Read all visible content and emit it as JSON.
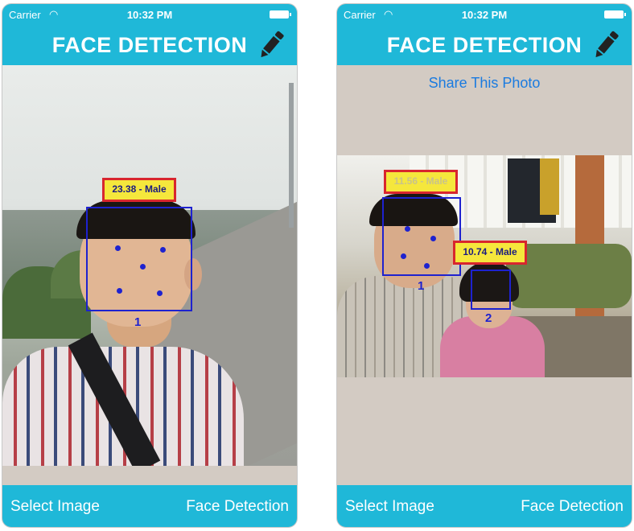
{
  "status": {
    "carrier": "Carrier",
    "time": "10:32 PM"
  },
  "header": {
    "title": "FACE DETECTION"
  },
  "share_label": "Share This Photo",
  "footer": {
    "left_label": "Select Image",
    "right_label": "Face Detection"
  },
  "left_screen": {
    "faces": [
      {
        "label": "23.38 - Male",
        "number": "1"
      }
    ]
  },
  "right_screen": {
    "faces": [
      {
        "label": "11.56 - Male",
        "number": "1"
      },
      {
        "label": "10.74 - Male",
        "number": "2"
      }
    ]
  },
  "colors": {
    "accent": "#1fb8d8",
    "link": "#1a7be0",
    "box": "#1e22cf",
    "label_bg": "#f5e73c",
    "label_border": "#d8262e"
  }
}
